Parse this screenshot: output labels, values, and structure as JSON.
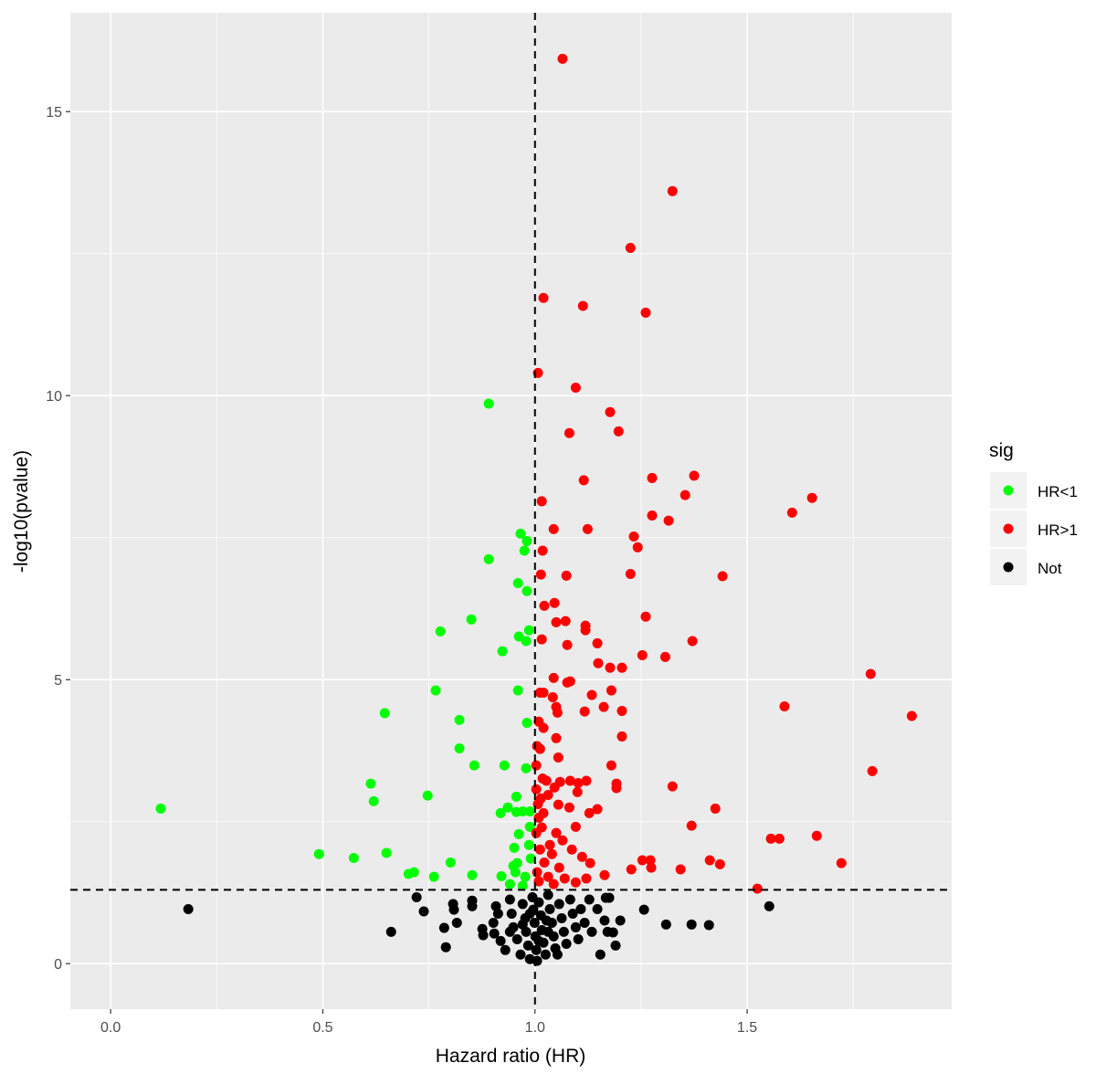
{
  "chart_data": {
    "type": "scatter",
    "title": "",
    "xlabel": "Hazard ratio (HR)",
    "ylabel": "-log10(pvalue)",
    "xlim": [
      -0.095,
      1.982
    ],
    "ylim": [
      -0.8,
      16.74
    ],
    "x_ticks": [
      0.0,
      0.5,
      1.0,
      1.5
    ],
    "x_tick_labels": [
      "0.0",
      "0.5",
      "1.0",
      "1.5"
    ],
    "y_ticks": [
      0,
      5,
      10,
      15
    ],
    "y_tick_labels": [
      "0",
      "5",
      "10",
      "15"
    ],
    "grid": true,
    "reference_lines": [
      {
        "orientation": "vertical",
        "value": 1.0,
        "style": "dashed"
      },
      {
        "orientation": "horizontal",
        "value": 1.301,
        "style": "dashed"
      }
    ],
    "legend": {
      "title": "sig",
      "position": "right",
      "entries": [
        {
          "label": "HR<1",
          "color": "#00ff00"
        },
        {
          "label": "HR>1",
          "color": "#ff0000"
        },
        {
          "label": "Not",
          "color": "#000000"
        }
      ]
    },
    "series": [
      {
        "name": "HR>1",
        "color": "#ff0000",
        "points": [
          [
            1.065,
            15.93
          ],
          [
            1.324,
            13.6
          ],
          [
            1.225,
            12.6
          ],
          [
            1.02,
            11.72
          ],
          [
            1.113,
            11.58
          ],
          [
            1.261,
            11.46
          ],
          [
            1.007,
            10.4
          ],
          [
            1.096,
            10.14
          ],
          [
            1.177,
            9.71
          ],
          [
            1.081,
            9.34
          ],
          [
            1.197,
            9.37
          ],
          [
            1.115,
            8.51
          ],
          [
            1.276,
            8.55
          ],
          [
            1.375,
            8.59
          ],
          [
            1.354,
            8.25
          ],
          [
            1.653,
            8.2
          ],
          [
            1.606,
            7.94
          ],
          [
            1.016,
            8.14
          ],
          [
            1.276,
            7.89
          ],
          [
            1.315,
            7.8
          ],
          [
            1.044,
            7.65
          ],
          [
            1.124,
            7.65
          ],
          [
            1.233,
            7.52
          ],
          [
            1.242,
            7.33
          ],
          [
            1.018,
            7.27
          ],
          [
            1.014,
            6.85
          ],
          [
            1.074,
            6.83
          ],
          [
            1.225,
            6.86
          ],
          [
            1.442,
            6.82
          ],
          [
            1.022,
            6.3
          ],
          [
            1.046,
            6.35
          ],
          [
            1.261,
            6.11
          ],
          [
            1.05,
            6.01
          ],
          [
            1.072,
            6.03
          ],
          [
            1.119,
            5.95
          ],
          [
            1.119,
            5.87
          ],
          [
            1.016,
            5.71
          ],
          [
            1.076,
            5.61
          ],
          [
            1.147,
            5.64
          ],
          [
            1.371,
            5.68
          ],
          [
            1.253,
            5.43
          ],
          [
            1.307,
            5.4
          ],
          [
            1.149,
            5.29
          ],
          [
            1.177,
            5.21
          ],
          [
            1.205,
            5.21
          ],
          [
            1.791,
            5.1
          ],
          [
            1.044,
            5.03
          ],
          [
            1.076,
            4.95
          ],
          [
            1.083,
            4.97
          ],
          [
            1.012,
            4.77
          ],
          [
            1.02,
            4.77
          ],
          [
            1.042,
            4.69
          ],
          [
            1.134,
            4.73
          ],
          [
            1.18,
            4.81
          ],
          [
            1.05,
            4.52
          ],
          [
            1.053,
            4.42
          ],
          [
            1.117,
            4.44
          ],
          [
            1.162,
            4.52
          ],
          [
            1.205,
            4.45
          ],
          [
            1.588,
            4.53
          ],
          [
            1.888,
            4.36
          ],
          [
            1.009,
            4.26
          ],
          [
            1.02,
            4.15
          ],
          [
            1.05,
            3.97
          ],
          [
            1.205,
            4.0
          ],
          [
            1.005,
            3.83
          ],
          [
            1.012,
            3.78
          ],
          [
            1.055,
            3.63
          ],
          [
            1.18,
            3.49
          ],
          [
            1.795,
            3.39
          ],
          [
            1.003,
            3.49
          ],
          [
            1.018,
            3.26
          ],
          [
            1.027,
            3.22
          ],
          [
            1.059,
            3.2
          ],
          [
            1.083,
            3.22
          ],
          [
            1.102,
            3.18
          ],
          [
            1.121,
            3.22
          ],
          [
            1.192,
            3.17
          ],
          [
            1.192,
            3.09
          ],
          [
            1.003,
            3.07
          ],
          [
            1.046,
            3.1
          ],
          [
            1.1,
            3.02
          ],
          [
            1.324,
            3.12
          ],
          [
            1.014,
            2.91
          ],
          [
            1.055,
            2.8
          ],
          [
            1.081,
            2.75
          ],
          [
            1.009,
            2.57
          ],
          [
            1.147,
            2.72
          ],
          [
            1.128,
            2.65
          ],
          [
            1.425,
            2.73
          ],
          [
            1.369,
            2.43
          ],
          [
            1.096,
            2.41
          ],
          [
            1.016,
            2.4
          ],
          [
            1.05,
            2.3
          ],
          [
            1.003,
            2.3
          ],
          [
            1.556,
            2.2
          ],
          [
            1.576,
            2.2
          ],
          [
            1.664,
            2.25
          ],
          [
            1.087,
            2.01
          ],
          [
            1.012,
            2.01
          ],
          [
            1.04,
            1.93
          ],
          [
            1.111,
            1.88
          ],
          [
            1.13,
            1.77
          ],
          [
            1.253,
            1.82
          ],
          [
            1.272,
            1.82
          ],
          [
            1.412,
            1.82
          ],
          [
            1.436,
            1.75
          ],
          [
            1.722,
            1.77
          ],
          [
            1.227,
            1.66
          ],
          [
            1.274,
            1.69
          ],
          [
            1.343,
            1.66
          ],
          [
            1.164,
            1.56
          ],
          [
            1.022,
            1.78
          ],
          [
            1.057,
            1.69
          ],
          [
            1.005,
            1.61
          ],
          [
            1.031,
            1.53
          ],
          [
            1.07,
            1.5
          ],
          [
            1.009,
            1.45
          ],
          [
            1.044,
            1.4
          ],
          [
            1.096,
            1.43
          ],
          [
            1.121,
            1.5
          ],
          [
            1.524,
            1.32
          ],
          [
            1.02,
            2.65
          ],
          [
            1.035,
            2.09
          ],
          [
            1.065,
            2.17
          ],
          [
            1.007,
            2.81
          ],
          [
            1.031,
            2.97
          ]
        ]
      },
      {
        "name": "HR<1",
        "color": "#00ff00",
        "points": [
          [
            0.891,
            9.86
          ],
          [
            0.966,
            7.57
          ],
          [
            0.981,
            7.44
          ],
          [
            0.975,
            7.27
          ],
          [
            0.891,
            7.12
          ],
          [
            0.96,
            6.7
          ],
          [
            0.981,
            6.56
          ],
          [
            0.85,
            6.06
          ],
          [
            0.777,
            5.85
          ],
          [
            0.986,
            5.87
          ],
          [
            0.962,
            5.76
          ],
          [
            0.979,
            5.68
          ],
          [
            0.923,
            5.5
          ],
          [
            0.766,
            4.81
          ],
          [
            0.96,
            4.81
          ],
          [
            0.646,
            4.41
          ],
          [
            0.822,
            4.29
          ],
          [
            0.981,
            4.24
          ],
          [
            0.822,
            3.79
          ],
          [
            0.857,
            3.49
          ],
          [
            0.928,
            3.49
          ],
          [
            0.979,
            3.44
          ],
          [
            0.613,
            3.17
          ],
          [
            0.62,
            2.86
          ],
          [
            0.747,
            2.96
          ],
          [
            0.956,
            2.94
          ],
          [
            0.919,
            2.65
          ],
          [
            0.936,
            2.75
          ],
          [
            0.956,
            2.67
          ],
          [
            0.971,
            2.68
          ],
          [
            0.988,
            2.68
          ],
          [
            0.118,
            2.73
          ],
          [
            0.962,
            2.28
          ],
          [
            0.988,
            2.41
          ],
          [
            0.951,
            2.04
          ],
          [
            0.986,
            2.09
          ],
          [
            0.491,
            1.93
          ],
          [
            0.573,
            1.86
          ],
          [
            0.65,
            1.95
          ],
          [
            0.801,
            1.78
          ],
          [
            0.702,
            1.58
          ],
          [
            0.715,
            1.61
          ],
          [
            0.762,
            1.53
          ],
          [
            0.852,
            1.56
          ],
          [
            0.921,
            1.54
          ],
          [
            0.949,
            1.72
          ],
          [
            0.958,
            1.77
          ],
          [
            0.954,
            1.61
          ],
          [
            0.977,
            1.53
          ],
          [
            0.941,
            1.4
          ],
          [
            0.971,
            1.37
          ],
          [
            0.99,
            1.85
          ]
        ]
      },
      {
        "name": "Not",
        "color": "#000000",
        "points": [
          [
            0.183,
            0.96
          ],
          [
            0.661,
            0.56
          ],
          [
            0.721,
            1.17
          ],
          [
            0.738,
            0.92
          ],
          [
            0.807,
            1.05
          ],
          [
            0.809,
            0.95
          ],
          [
            0.816,
            0.72
          ],
          [
            0.786,
            0.63
          ],
          [
            0.79,
            0.29
          ],
          [
            0.852,
            1.11
          ],
          [
            0.852,
            1.01
          ],
          [
            0.876,
            0.61
          ],
          [
            0.878,
            0.5
          ],
          [
            0.908,
            1.01
          ],
          [
            0.902,
            0.72
          ],
          [
            0.904,
            0.53
          ],
          [
            0.919,
            0.4
          ],
          [
            0.93,
            0.24
          ],
          [
            0.941,
            1.13
          ],
          [
            0.945,
            0.88
          ],
          [
            0.949,
            0.64
          ],
          [
            0.958,
            0.43
          ],
          [
            0.966,
            0.16
          ],
          [
            0.971,
            1.05
          ],
          [
            0.977,
            0.8
          ],
          [
            0.979,
            0.56
          ],
          [
            0.984,
            0.32
          ],
          [
            0.988,
            0.08
          ],
          [
            0.994,
            1.17
          ],
          [
            0.996,
            0.95
          ],
          [
            0.999,
            0.72
          ],
          [
            1.001,
            0.48
          ],
          [
            1.003,
            0.24
          ],
          [
            1.005,
            0.05
          ],
          [
            1.009,
            1.08
          ],
          [
            1.014,
            0.85
          ],
          [
            1.016,
            0.59
          ],
          [
            1.02,
            0.37
          ],
          [
            1.025,
            0.16
          ],
          [
            1.031,
            1.21
          ],
          [
            1.035,
            0.96
          ],
          [
            1.04,
            0.72
          ],
          [
            1.044,
            0.48
          ],
          [
            1.048,
            0.27
          ],
          [
            1.057,
            1.05
          ],
          [
            1.063,
            0.8
          ],
          [
            1.068,
            0.56
          ],
          [
            1.074,
            0.35
          ],
          [
            1.083,
            1.13
          ],
          [
            1.089,
            0.88
          ],
          [
            1.096,
            0.64
          ],
          [
            1.102,
            0.43
          ],
          [
            1.108,
            0.96
          ],
          [
            1.117,
            0.72
          ],
          [
            1.128,
            1.13
          ],
          [
            1.134,
            0.56
          ],
          [
            1.147,
            0.96
          ],
          [
            1.167,
            1.16
          ],
          [
            1.175,
            1.16
          ],
          [
            1.164,
            0.76
          ],
          [
            1.201,
            0.76
          ],
          [
            1.171,
            0.56
          ],
          [
            1.184,
            0.55
          ],
          [
            1.19,
            0.32
          ],
          [
            1.154,
            0.16
          ],
          [
            1.257,
            0.95
          ],
          [
            1.309,
            0.69
          ],
          [
            1.369,
            0.69
          ],
          [
            1.41,
            0.68
          ],
          [
            1.552,
            1.01
          ],
          [
            0.941,
            0.56
          ],
          [
            0.913,
            0.88
          ],
          [
            0.971,
            0.69
          ],
          [
            1.009,
            0.4
          ],
          [
            1.031,
            0.56
          ],
          [
            1.053,
            0.16
          ],
          [
            0.988,
            0.88
          ],
          [
            1.027,
            0.76
          ]
        ]
      }
    ]
  },
  "style": {
    "panel_background": "#ebebeb",
    "gridline_color": "#ffffff",
    "tick_color": "#333333",
    "reference_line_color": "#000000"
  }
}
